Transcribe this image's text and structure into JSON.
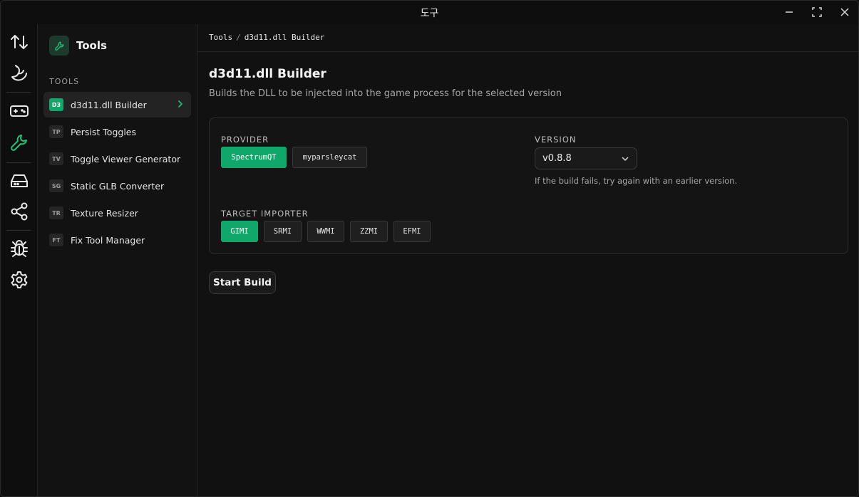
{
  "window": {
    "title": "도구"
  },
  "rail": {
    "items": [
      {
        "icon": "sort-arrows-icon",
        "active": false
      },
      {
        "icon": "banana-icon",
        "active": false
      },
      {
        "icon": "gamepad-icon",
        "active": false
      },
      {
        "icon": "wrench-icon",
        "active": true
      },
      {
        "icon": "drive-icon",
        "active": false
      },
      {
        "icon": "share-icon",
        "active": false
      },
      {
        "icon": "bug-icon",
        "active": false
      },
      {
        "icon": "gear-icon",
        "active": false
      }
    ]
  },
  "sidebar": {
    "title": "Tools",
    "section": "TOOLS",
    "items": [
      {
        "badge": "D3",
        "label": "d3d11.dll Builder",
        "active": true
      },
      {
        "badge": "TP",
        "label": "Persist Toggles",
        "active": false
      },
      {
        "badge": "TV",
        "label": "Toggle Viewer Generator",
        "active": false
      },
      {
        "badge": "SG",
        "label": "Static GLB Converter",
        "active": false
      },
      {
        "badge": "TR",
        "label": "Texture Resizer",
        "active": false
      },
      {
        "badge": "FT",
        "label": "Fix Tool Manager",
        "active": false
      }
    ]
  },
  "breadcrumb": {
    "root": "Tools",
    "separator": "/",
    "current": "d3d11.dll Builder"
  },
  "main": {
    "title": "d3d11.dll Builder",
    "subtitle": "Builds the DLL to be injected into the game process for the selected version",
    "provider": {
      "label": "PROVIDER",
      "options": [
        "SpectrumQT",
        "myparsleycat"
      ],
      "selected": "SpectrumQT"
    },
    "version": {
      "label": "VERSION",
      "value": "v0.8.8",
      "hint": "If the build fails, try again with an earlier version."
    },
    "importer": {
      "label": "TARGET IMPORTER",
      "options": [
        "GIMI",
        "SRMI",
        "WWMI",
        "ZZMI",
        "EFMI"
      ],
      "selected": "GIMI"
    },
    "start_label": "Start Build"
  },
  "colors": {
    "accent": "#10a86a",
    "accent_icon": "#22c17c",
    "background": "#111111"
  }
}
